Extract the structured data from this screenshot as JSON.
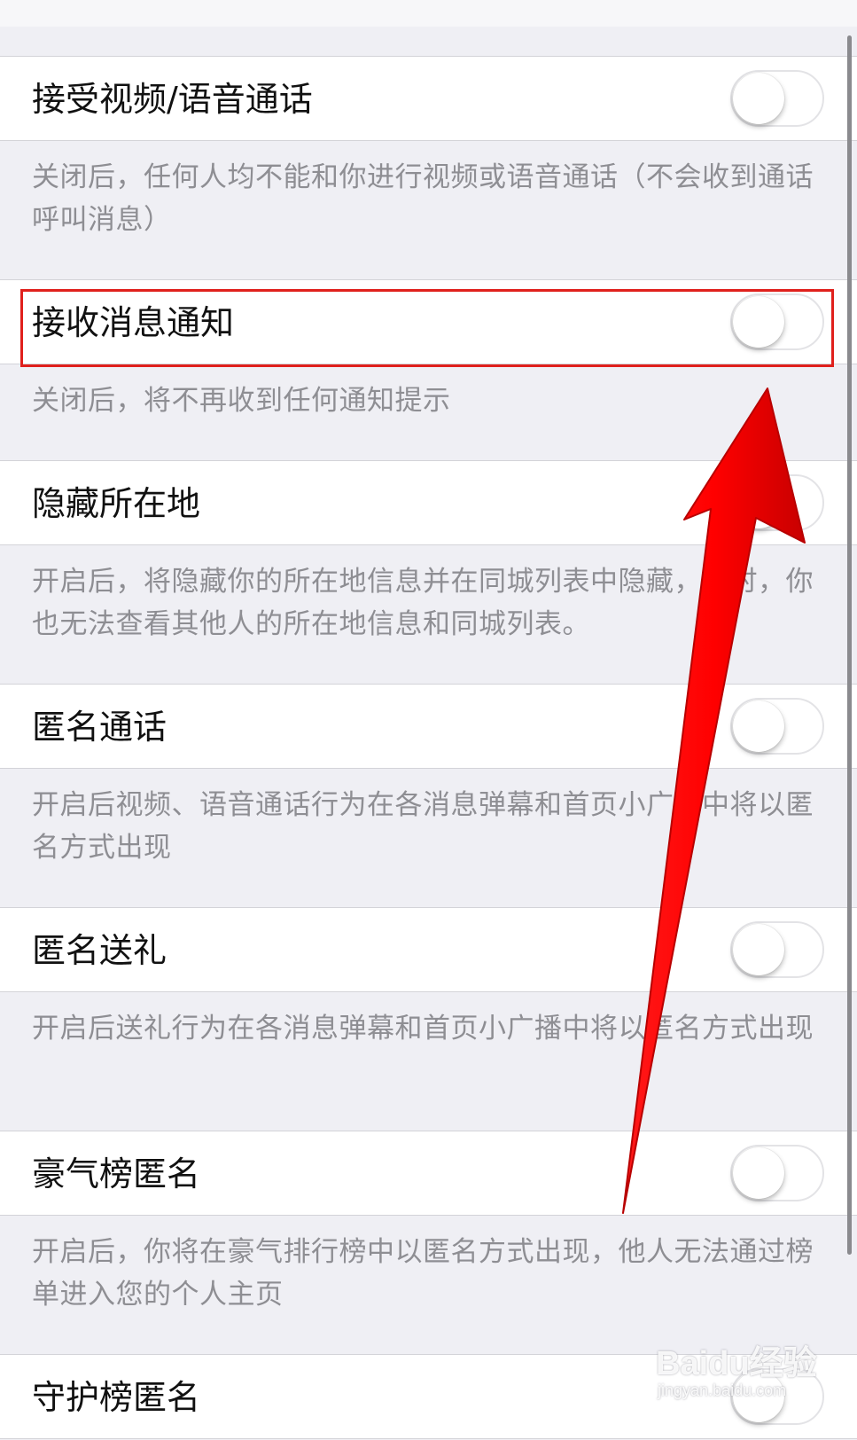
{
  "settings": [
    {
      "label": "接受视频/语音通话",
      "enabled": false,
      "description": "关闭后，任何人均不能和你进行视频或语音通话（不会收到通话呼叫消息）"
    },
    {
      "label": "接收消息通知",
      "enabled": false,
      "description": "关闭后，将不再收到任何通知提示"
    },
    {
      "label": "隐藏所在地",
      "enabled": false,
      "description": "开启后，将隐藏你的所在地信息并在同城列表中隐藏，同时，你也无法查看其他人的所在地信息和同城列表。"
    },
    {
      "label": "匿名通话",
      "enabled": false,
      "description": "开启后视频、语音通话行为在各消息弹幕和首页小广播中将以匿名方式出现"
    },
    {
      "label": "匿名送礼",
      "enabled": false,
      "description": "开启后送礼行为在各消息弹幕和首页小广播中将以匿名方式出现"
    },
    {
      "label": "豪气榜匿名",
      "enabled": false,
      "description": "开启后，你将在豪气排行榜中以匿名方式出现，他人无法通过榜单进入您的个人主页"
    },
    {
      "label": "守护榜匿名",
      "enabled": false,
      "description": ""
    }
  ],
  "annotation": {
    "highlight_color": "#e0201c",
    "arrow_color": "#ff0000"
  },
  "watermark": {
    "brand": "Baidu经验",
    "sub": "jingyan.baidu.com"
  }
}
